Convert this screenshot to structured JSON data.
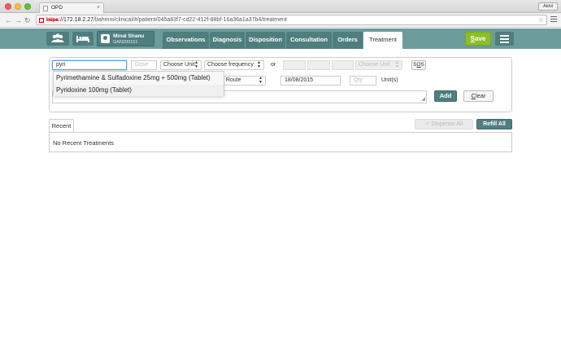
{
  "browser": {
    "tab_title": "OPD",
    "tab_close": "×",
    "user_chip": "Akhil",
    "back": "←",
    "forward": "→",
    "reload": "↻",
    "url_protocol": "https",
    "url_host": "://172.18.2.27",
    "url_path": "/bahmni/clinical/#/patient/045a83f7-cd22-412f-88bf-16a36a1a37b4/treatment",
    "star": "☆"
  },
  "header": {
    "patient_name": "Minal Shanu",
    "patient_id": "GAN200151",
    "tabs": [
      {
        "label": "Observations",
        "active": false
      },
      {
        "label": "Diagnosis",
        "active": false
      },
      {
        "label": "Disposition",
        "active": false
      },
      {
        "label": "Consultation",
        "active": false
      },
      {
        "label": "Orders",
        "active": false
      },
      {
        "label": "Treatment",
        "active": true
      }
    ],
    "save_first": "S",
    "save_rest": "ave",
    "accent": "#8cbf26",
    "header_color": "#6c9c9c"
  },
  "form": {
    "drug_value": "pyri",
    "dose_placeholder": "Dose",
    "unit_select": "Choose Unit",
    "frequency_select": "Choose frequency",
    "or_label": "or",
    "unit_select_disabled": "Choose Unit",
    "sos_first": "S",
    "sos_mid": "O",
    "sos_last": "S",
    "route_select": "e Route",
    "start_date": "18/08/2015",
    "qty_placeholder": "Qty",
    "qty_unit": "Unit(s)",
    "add_label": "Add",
    "clear_first": "C",
    "clear_rest": "lear"
  },
  "autocomplete": {
    "items": [
      "Pyrimethamine & Sulfadoxine 25mg + 500mg (Tablet)",
      "Pyridoxine 100mg (Tablet)"
    ]
  },
  "recent": {
    "tab_label": "Recent",
    "empty_text": "No Recent Treatments",
    "dispense_label": "Dispense All",
    "refill_label": "Refill All"
  }
}
